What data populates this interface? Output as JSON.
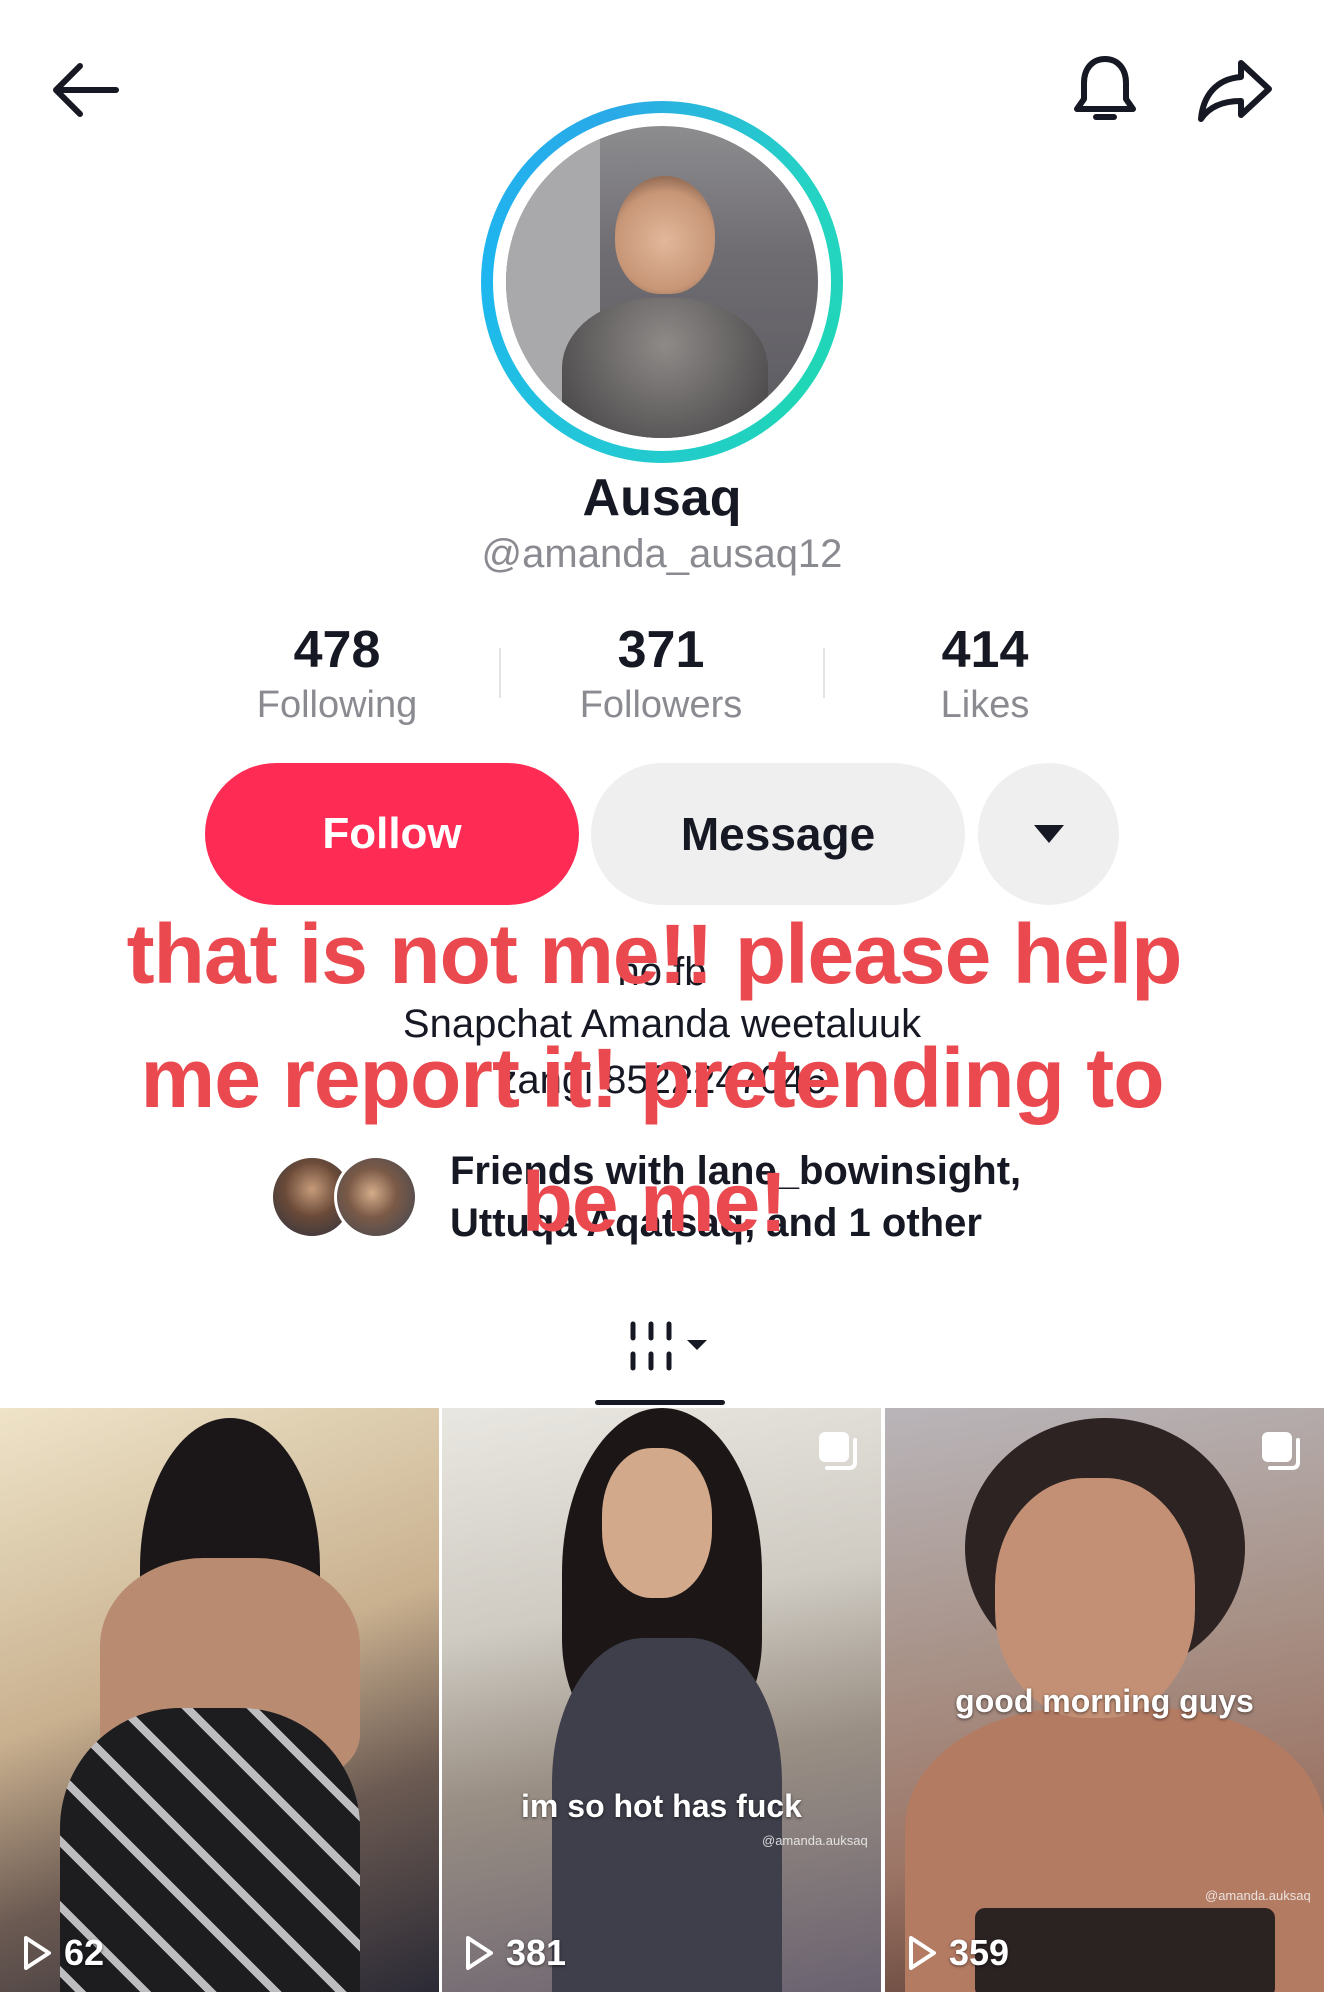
{
  "header": {
    "back_icon": "arrow-left-icon",
    "bell_icon": "bell-icon",
    "share_icon": "share-arrow-icon"
  },
  "profile": {
    "display_name": "Ausaq",
    "username": "@amanda_ausaq12",
    "avatar_ring_colors": [
      "#1db6f0",
      "#25d3c4"
    ]
  },
  "stats": [
    {
      "value": "478",
      "label": "Following"
    },
    {
      "value": "371",
      "label": "Followers"
    },
    {
      "value": "414",
      "label": "Likes"
    }
  ],
  "actions": {
    "follow_label": "Follow",
    "message_label": "Message",
    "more_icon": "caret-down-icon",
    "follow_color": "#fe2c55"
  },
  "bio": {
    "line1": "no fb",
    "line2": "Snapchat Amanda weetaluuk",
    "line3": "zangi 8522247046"
  },
  "friends": {
    "line1": "Friends with lane_bowinsight,",
    "line2": "Uttuqa Aqatsaq, and 1 other"
  },
  "overlay_text": {
    "line1": "that is not me!! please help",
    "line2": "me report it! pretending to",
    "line3": "be me!",
    "color": "#ea4a4f"
  },
  "tabs": {
    "grid_icon": "grid-view-icon"
  },
  "videos": [
    {
      "views": "62",
      "caption": "",
      "watermark": "",
      "multi": false
    },
    {
      "views": "381",
      "caption": "im so hot has fuck",
      "watermark": "@amanda.auksaq",
      "multi": true
    },
    {
      "views": "359",
      "caption": "good morning guys",
      "watermark": "@amanda.auksaq",
      "multi": true
    }
  ]
}
